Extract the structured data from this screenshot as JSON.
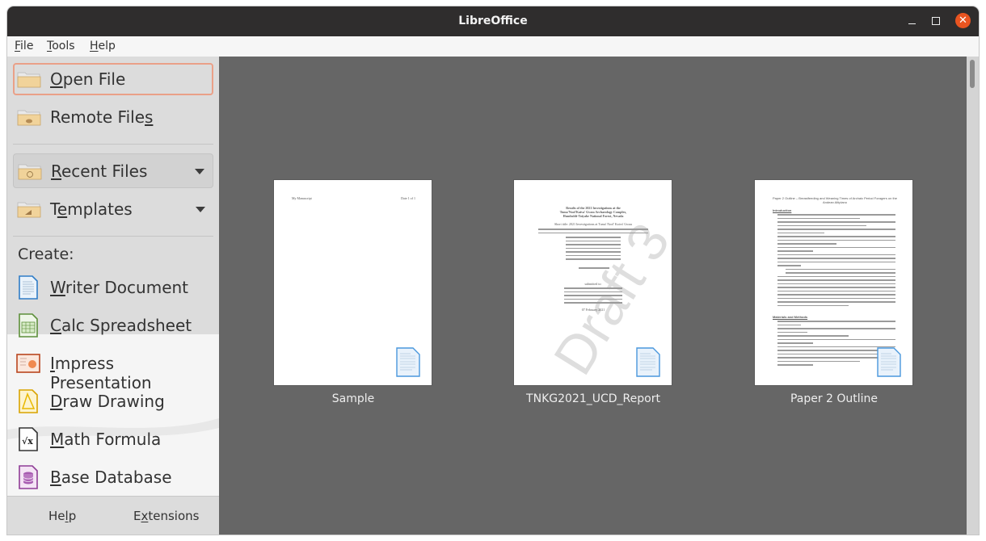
{
  "window": {
    "title": "LibreOffice",
    "controls": {
      "minimize": "minimize",
      "maximize": "maximize",
      "close": "✕"
    },
    "accent_color": "#e95420"
  },
  "menubar": {
    "items": [
      {
        "label": "File",
        "mnemonic": "F"
      },
      {
        "label": "Tools",
        "mnemonic": "T"
      },
      {
        "label": "Help",
        "mnemonic": "H"
      }
    ]
  },
  "sidebar": {
    "open_file": {
      "label": "Open File",
      "icon": "folder-icon"
    },
    "remote_files": {
      "label": "Remote Files",
      "icon": "cloud-folder-icon"
    },
    "recent_files": {
      "label": "Recent Files",
      "icon": "history-folder-icon"
    },
    "templates": {
      "label": "Templates",
      "icon": "template-folder-icon"
    },
    "create_label": "Create:",
    "create_items": [
      {
        "label": "Writer Document",
        "icon": "writer-icon"
      },
      {
        "label": "Calc Spreadsheet",
        "icon": "calc-icon"
      },
      {
        "label": "Impress Presentation",
        "icon": "impress-icon"
      },
      {
        "label": "Draw Drawing",
        "icon": "draw-icon"
      },
      {
        "label": "Math Formula",
        "icon": "math-icon"
      },
      {
        "label": "Base Database",
        "icon": "base-icon"
      }
    ],
    "footer": {
      "help": "Help",
      "extensions": "Extensions"
    }
  },
  "recent_documents": [
    {
      "name": "Sample",
      "preview": {
        "header_left": "My Manuscript",
        "header_right": "Date 1 of 1"
      }
    },
    {
      "name": "TNKG2021_UCD_Report",
      "preview": {
        "title": "Results of the 2021 Investigations at the Tuma'Nool'Kaiva' Gwuu Archaeology Complex, Humboldt-Toiyabe National Forest, Nevada",
        "short_title": "Short title: 2021 Investigations at Tuma' Nool' Kaiva' Gwuu",
        "submitted_to": "submitted to:",
        "date": "07 February 2021",
        "watermark": "Draft 3"
      }
    },
    {
      "name": "Paper 2 Outline",
      "preview": {
        "title": "Paper 2 Outline – Breastfeeding and Weaning Times of Archaic Period Foragers on the Andean Altiplano",
        "section1": "Introduction",
        "section2": "Materials and Methods"
      }
    }
  ]
}
